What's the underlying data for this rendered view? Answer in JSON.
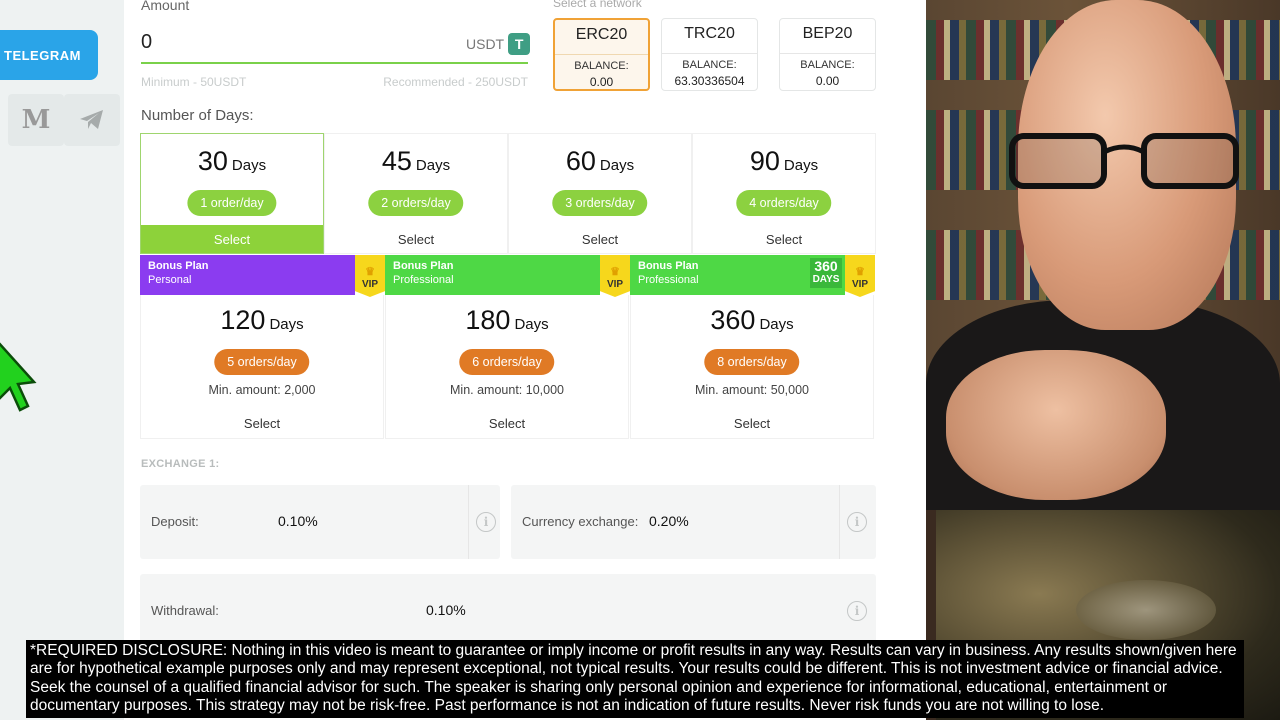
{
  "sidebar": {
    "telegram_label": "TELEGRAM",
    "medium_glyph": "M",
    "telegram_icon_glyph": "➤"
  },
  "amount": {
    "label": "Amount",
    "value": "0",
    "currency": "USDT",
    "currency_icon": "T",
    "minimum_hint": "Minimum - 50USDT",
    "recommended_hint": "Recommended - 250USDT"
  },
  "network": {
    "label": "Select a network",
    "balance_label": "BALANCE:",
    "options": [
      {
        "name": "ERC20",
        "balance": "0.00",
        "selected": true
      },
      {
        "name": "TRC20",
        "balance": "63.30336504",
        "selected": false
      },
      {
        "name": "BEP20",
        "balance": "0.00",
        "selected": false
      }
    ]
  },
  "days": {
    "label": "Number of Days:",
    "unit": "Days",
    "select_label": "Select",
    "basic_plans": [
      {
        "days": "30",
        "orders": "1 order/day",
        "selected": true
      },
      {
        "days": "45",
        "orders": "2 orders/day",
        "selected": false
      },
      {
        "days": "60",
        "orders": "3 orders/day",
        "selected": false
      },
      {
        "days": "90",
        "orders": "4 orders/day",
        "selected": false
      }
    ],
    "bonus_plans": [
      {
        "title": "Bonus Plan",
        "tier": "Personal",
        "vip": "VIP",
        "days": "120",
        "orders": "5 orders/day",
        "min_amount": "Min. amount: 2,000",
        "color": "#8b3cf0"
      },
      {
        "title": "Bonus Plan",
        "tier": "Professional",
        "vip": "VIP",
        "days": "180",
        "orders": "6 orders/day",
        "min_amount": "Min. amount: 10,000",
        "color": "#4ed845"
      },
      {
        "title": "Bonus Plan",
        "tier": "Professional",
        "vip": "VIP",
        "days": "360",
        "orders": "8 orders/day",
        "min_amount": "Min. amount: 50,000",
        "color": "#4ed845",
        "badge_num": "360",
        "badge_unit": "DAYS"
      }
    ]
  },
  "exchange": {
    "label": "EXCHANGE 1:",
    "deposit_label": "Deposit:",
    "deposit_value": "0.10%",
    "currency_exchange_label": "Currency exchange:",
    "currency_exchange_value": "0.20%",
    "withdrawal_label": "Withdrawal:",
    "withdrawal_value": "0.10%",
    "info_glyph": "i"
  },
  "disclosure": "*REQUIRED DISCLOSURE: Nothing in this video is meant to guarantee or imply income or profit results in any way. Results can vary in business. Any results shown/given here are for hypothetical example purposes only and may represent exceptional, not typical results. Your results could be different. This is not investment advice or financial advice. Seek the counsel of a qualified financial advisor for such. The speaker is sharing only personal opinion and experience for informational, educational, entertainment or documentary purposes. This strategy may not be risk-free. Past performance is not an indication of future results. Never risk funds you are not willing to lose.",
  "colors": {
    "accent_green": "#8dd23a",
    "telegram_blue": "#2aa4e8",
    "selected_network_border": "#f0a236",
    "bonus_orange": "#e07a25",
    "vip_yellow": "#f6d71c"
  }
}
